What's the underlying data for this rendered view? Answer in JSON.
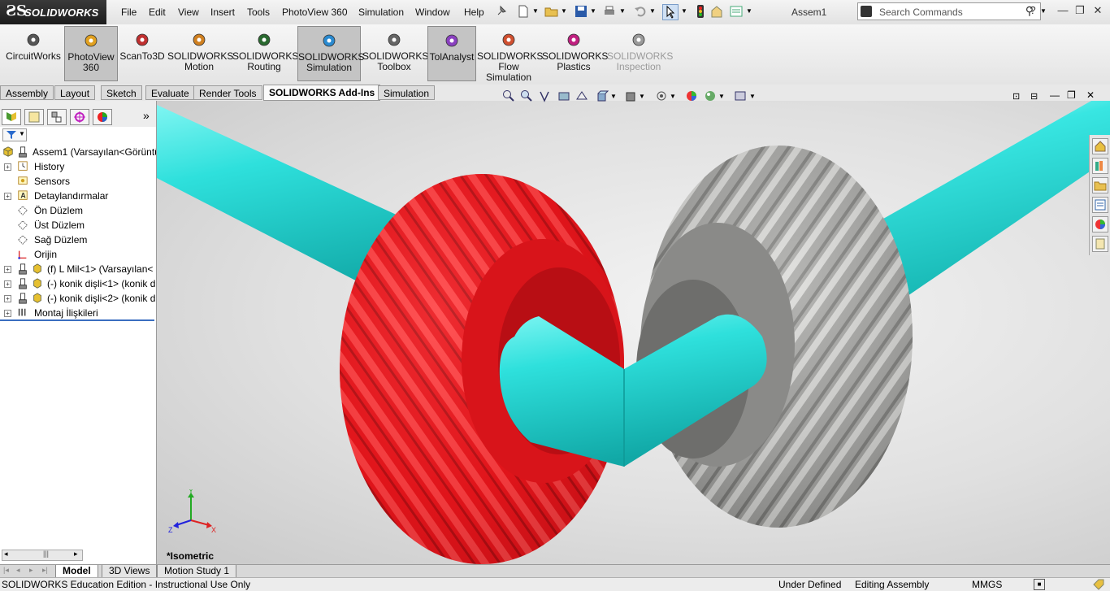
{
  "window": {
    "logo_text": "SOLIDWORKS",
    "document_title": "Assem1",
    "search_placeholder": "Search Commands"
  },
  "menu": [
    "File",
    "Edit",
    "View",
    "Insert",
    "Tools",
    "PhotoView 360",
    "Simulation",
    "Window",
    "Help"
  ],
  "command_manager": [
    {
      "line1": "CircuitWorks",
      "line2": "",
      "line3": "",
      "icon": "circuitworks-icon",
      "state": "normal"
    },
    {
      "line1": "PhotoView",
      "line2": "360",
      "line3": "",
      "icon": "photoview-icon",
      "state": "active"
    },
    {
      "line1": "ScanTo3D",
      "line2": "",
      "line3": "",
      "icon": "scanto3d-icon",
      "state": "normal"
    },
    {
      "line1": "SOLIDWORKS",
      "line2": "Motion",
      "line3": "",
      "icon": "motion-icon",
      "state": "normal"
    },
    {
      "line1": "SOLIDWORKS",
      "line2": "Routing",
      "line3": "",
      "icon": "routing-icon",
      "state": "normal"
    },
    {
      "line1": "SOLIDWORKS",
      "line2": "Simulation",
      "line3": "",
      "icon": "simulation-icon",
      "state": "active"
    },
    {
      "line1": "SOLIDWORKS",
      "line2": "Toolbox",
      "line3": "",
      "icon": "toolbox-icon",
      "state": "normal"
    },
    {
      "line1": "TolAnalyst",
      "line2": "",
      "line3": "",
      "icon": "tolanalyst-icon",
      "state": "active"
    },
    {
      "line1": "SOLIDWORKS",
      "line2": "Flow",
      "line3": "Simulation",
      "icon": "flow-icon",
      "state": "normal"
    },
    {
      "line1": "SOLIDWORKS",
      "line2": "Plastics",
      "line3": "",
      "icon": "plastics-icon",
      "state": "normal"
    },
    {
      "line1": "SOLIDWORKS",
      "line2": "Inspection",
      "line3": "",
      "icon": "inspection-icon",
      "state": "disabled"
    }
  ],
  "tabs": [
    "Assembly",
    "Layout",
    "Sketch",
    "Evaluate",
    "Render Tools",
    "SOLIDWORKS Add-Ins",
    "Simulation"
  ],
  "active_tab": "SOLIDWORKS Add-Ins",
  "feature_tree": [
    {
      "label": "Assem1  (Varsayılan<Görüntü",
      "icon": "assembly-icon",
      "expander": "",
      "indent": 0
    },
    {
      "label": "History",
      "icon": "history-icon",
      "expander": "+",
      "indent": 1
    },
    {
      "label": "Sensors",
      "icon": "sensors-icon",
      "expander": "",
      "indent": 1
    },
    {
      "label": "Detaylandırmalar",
      "icon": "annotations-icon",
      "expander": "+",
      "indent": 1
    },
    {
      "label": "Ön Düzlem",
      "icon": "plane-icon",
      "expander": "",
      "indent": 1
    },
    {
      "label": "Üst Düzlem",
      "icon": "plane-icon",
      "expander": "",
      "indent": 1
    },
    {
      "label": "Sağ Düzlem",
      "icon": "plane-icon",
      "expander": "",
      "indent": 1
    },
    {
      "label": "Orijin",
      "icon": "origin-icon",
      "expander": "",
      "indent": 1
    },
    {
      "label": "(f) L Mil<1> (Varsayılan<",
      "icon": "part-icon",
      "expander": "+",
      "indent": 1
    },
    {
      "label": "(-) konik dişli<1> (konik d",
      "icon": "part-icon",
      "expander": "+",
      "indent": 1
    },
    {
      "label": "(-) konik dişli<2> (konik d",
      "icon": "part-icon",
      "expander": "+",
      "indent": 1
    },
    {
      "label": "Montaj İlişkileri",
      "icon": "mates-icon",
      "expander": "+",
      "indent": 1
    }
  ],
  "viewport": {
    "view_label": "*Isometric",
    "triad": {
      "x": "X",
      "y": "Y",
      "z": "Z"
    }
  },
  "bottom_tabs": [
    "Model",
    "3D Views",
    "Motion Study 1"
  ],
  "active_bottom_tab": "Model",
  "status": {
    "left": "SOLIDWORKS Education Edition - Instructional Use Only",
    "definition": "Under Defined",
    "mode": "Editing Assembly",
    "units": "MMGS"
  },
  "colors": {
    "gear_red": "#e0141a",
    "gear_gray": "#9a9a98",
    "shaft_cyan": "#2ee0dc"
  }
}
